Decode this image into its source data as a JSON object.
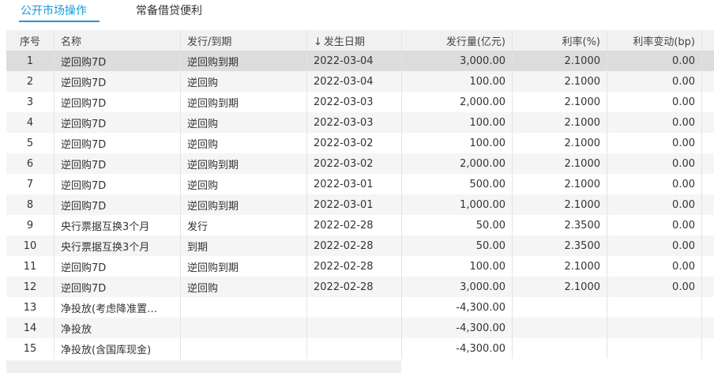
{
  "tabs": [
    {
      "label": "公开市场操作",
      "active": true
    },
    {
      "label": "常备借贷便利",
      "active": false
    }
  ],
  "table": {
    "columns": [
      "序号",
      "名称",
      "发行/到期",
      "发生日期",
      "发行量(亿元)",
      "利率(%)",
      "利率变动(bp)"
    ],
    "sort_icon": "↓",
    "rows": [
      [
        "1",
        "逆回购7D",
        "逆回购到期",
        "2022-03-04",
        "3,000.00",
        "2.1000",
        "0.00"
      ],
      [
        "2",
        "逆回购7D",
        "逆回购",
        "2022-03-04",
        "100.00",
        "2.1000",
        "0.00"
      ],
      [
        "3",
        "逆回购7D",
        "逆回购到期",
        "2022-03-03",
        "2,000.00",
        "2.1000",
        "0.00"
      ],
      [
        "4",
        "逆回购7D",
        "逆回购",
        "2022-03-03",
        "100.00",
        "2.1000",
        "0.00"
      ],
      [
        "5",
        "逆回购7D",
        "逆回购",
        "2022-03-02",
        "100.00",
        "2.1000",
        "0.00"
      ],
      [
        "6",
        "逆回购7D",
        "逆回购到期",
        "2022-03-02",
        "2,000.00",
        "2.1000",
        "0.00"
      ],
      [
        "7",
        "逆回购7D",
        "逆回购",
        "2022-03-01",
        "500.00",
        "2.1000",
        "0.00"
      ],
      [
        "8",
        "逆回购7D",
        "逆回购到期",
        "2022-03-01",
        "1,000.00",
        "2.1000",
        "0.00"
      ],
      [
        "9",
        "央行票据互换3个月",
        "发行",
        "2022-02-28",
        "50.00",
        "2.3500",
        "0.00"
      ],
      [
        "10",
        "央行票据互换3个月",
        "到期",
        "2022-02-28",
        "50.00",
        "2.3500",
        "0.00"
      ],
      [
        "11",
        "逆回购7D",
        "逆回购到期",
        "2022-02-28",
        "100.00",
        "2.1000",
        "0.00"
      ],
      [
        "12",
        "逆回购7D",
        "逆回购",
        "2022-02-28",
        "3,000.00",
        "2.1000",
        "0.00"
      ],
      [
        "13",
        "净投放(考虑降准置…",
        "",
        "",
        "-4,300.00",
        "",
        ""
      ],
      [
        "14",
        "净投放",
        "",
        "",
        "-4,300.00",
        "",
        ""
      ],
      [
        "15",
        "净投放(含国库现金)",
        "",
        "",
        "-4,300.00",
        "",
        ""
      ]
    ],
    "selected_row": 1
  }
}
